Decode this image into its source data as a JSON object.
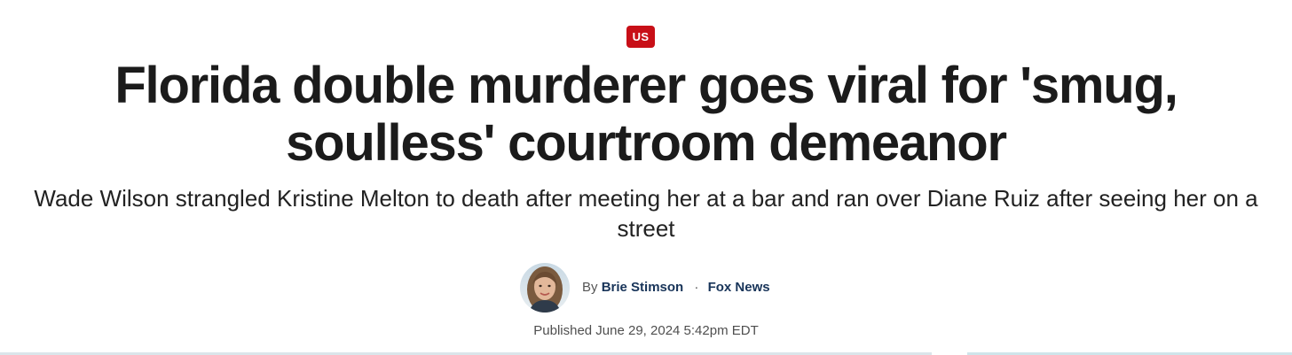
{
  "article": {
    "category": "US",
    "headline": "Florida double murderer goes viral for 'smug, soulless' courtroom demeanor",
    "subheadline": "Wade Wilson strangled Kristine Melton to death after meeting her at a bar and ran over Diane Ruiz after seeing her on a street",
    "byline": {
      "prefix": "By",
      "author": "Brie Stimson",
      "separator": "·",
      "source": "Fox News"
    },
    "published": "Published June 29, 2024 5:42pm EDT"
  },
  "colors": {
    "badge": "#c80f17",
    "link": "#183459",
    "headline": "#1b1b1b"
  }
}
